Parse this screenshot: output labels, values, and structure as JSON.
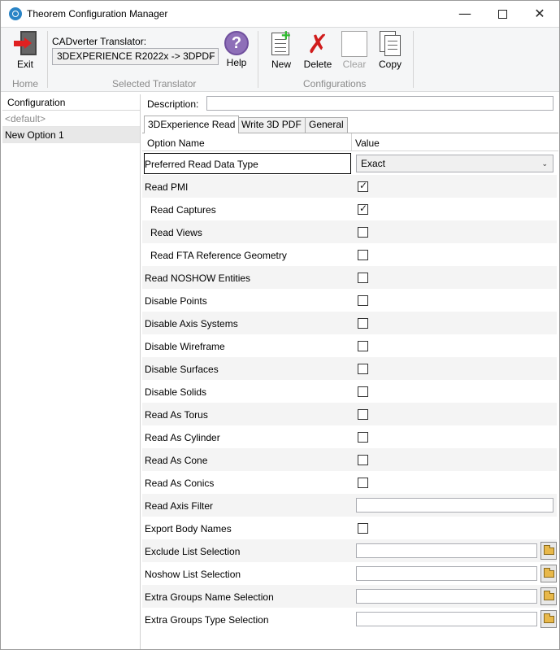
{
  "window": {
    "title": "Theorem Configuration Manager",
    "controls": {
      "minimize": "—",
      "close": "✕"
    }
  },
  "ribbon": {
    "exit_label": "Exit",
    "home_group": "Home",
    "translator_label": "CADverter Translator:",
    "translator_value": "3DEXPERIENCE R2022x -> 3DPDF",
    "help_label": "Help",
    "help_glyph": "?",
    "selected_translator_group": "Selected Translator",
    "new_label": "New",
    "delete_label": "Delete",
    "clear_label": "Clear",
    "copy_label": "Copy",
    "delete_glyph": "✗",
    "configurations_group": "Configurations"
  },
  "left_panel": {
    "header": "Configuration",
    "items": [
      {
        "label": "<default>"
      },
      {
        "label": "New Option 1"
      }
    ]
  },
  "description": {
    "label": "Description:",
    "value": ""
  },
  "tabs": [
    {
      "label": "3DExperience Read"
    },
    {
      "label": "Write 3D PDF"
    },
    {
      "label": "General"
    }
  ],
  "grid": {
    "col_name": "Option Name",
    "col_value": "Value",
    "check_glyph": "✓",
    "arrow_glyph": "⌄",
    "rows": [
      {
        "name": "Preferred Read Data Type",
        "type": "dropdown",
        "value": "Exact"
      },
      {
        "name": "Read PMI",
        "type": "checkbox",
        "checked": true
      },
      {
        "name": "Read Captures",
        "type": "checkbox",
        "checked": true
      },
      {
        "name": "Read Views",
        "type": "checkbox",
        "checked": false
      },
      {
        "name": "Read FTA Reference Geometry",
        "type": "checkbox",
        "checked": false
      },
      {
        "name": "Read NOSHOW Entities",
        "type": "checkbox",
        "checked": false
      },
      {
        "name": "Disable Points",
        "type": "checkbox",
        "checked": false
      },
      {
        "name": "Disable Axis Systems",
        "type": "checkbox",
        "checked": false
      },
      {
        "name": "Disable Wireframe",
        "type": "checkbox",
        "checked": false
      },
      {
        "name": "Disable Surfaces",
        "type": "checkbox",
        "checked": false
      },
      {
        "name": "Disable Solids",
        "type": "checkbox",
        "checked": false
      },
      {
        "name": "Read As Torus",
        "type": "checkbox",
        "checked": false
      },
      {
        "name": "Read As Cylinder",
        "type": "checkbox",
        "checked": false
      },
      {
        "name": "Read As Cone",
        "type": "checkbox",
        "checked": false
      },
      {
        "name": "Read As Conics",
        "type": "checkbox",
        "checked": false
      },
      {
        "name": "Read Axis Filter",
        "type": "text",
        "value": ""
      },
      {
        "name": "Export Body Names",
        "type": "checkbox",
        "checked": false
      },
      {
        "name": "Exclude List Selection",
        "type": "file",
        "value": ""
      },
      {
        "name": "Noshow List Selection",
        "type": "file",
        "value": ""
      },
      {
        "name": "Extra Groups Name Selection",
        "type": "file",
        "value": ""
      },
      {
        "name": "Extra Groups Type Selection",
        "type": "file",
        "value": ""
      }
    ]
  }
}
